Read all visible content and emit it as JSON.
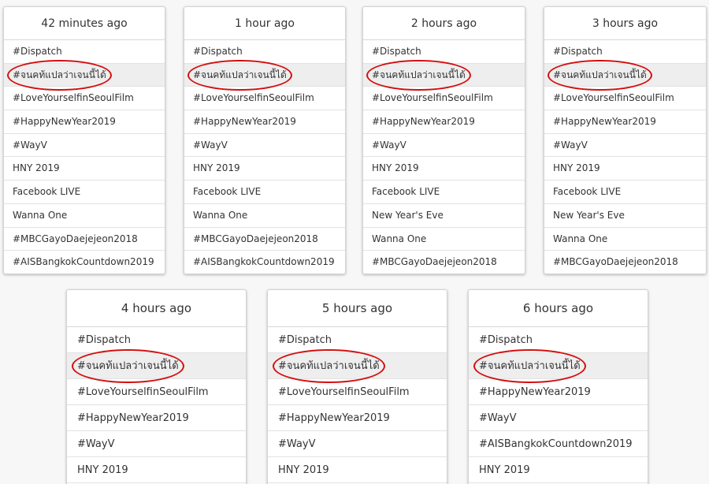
{
  "panels": [
    {
      "header": "42 minutes ago",
      "items": [
        "#Dispatch",
        "#จนคท้แปลว่าเจนนี้ได้",
        "#LoveYourselfinSeoulFilm",
        "#HappyNewYear2019",
        "#WayV",
        "HNY 2019",
        "Facebook LIVE",
        "Wanna One",
        "#MBCGayoDaejejeon2018",
        "#AISBangkokCountdown2019"
      ]
    },
    {
      "header": "1 hour ago",
      "items": [
        "#Dispatch",
        "#จนคท้แปลว่าเจนนี้ได้",
        "#LoveYourselfinSeoulFilm",
        "#HappyNewYear2019",
        "#WayV",
        "HNY 2019",
        "Facebook LIVE",
        "Wanna One",
        "#MBCGayoDaejejeon2018",
        "#AISBangkokCountdown2019"
      ]
    },
    {
      "header": "2 hours ago",
      "items": [
        "#Dispatch",
        "#จนคท้แปลว่าเจนนี้ได้",
        "#LoveYourselfinSeoulFilm",
        "#HappyNewYear2019",
        "#WayV",
        "HNY 2019",
        "Facebook LIVE",
        "New Year's Eve",
        "Wanna One",
        "#MBCGayoDaejejeon2018"
      ]
    },
    {
      "header": "3 hours ago",
      "items": [
        "#Dispatch",
        "#จนคท้แปลว่าเจนนี้ได้",
        "#LoveYourselfinSeoulFilm",
        "#HappyNewYear2019",
        "#WayV",
        "HNY 2019",
        "Facebook LIVE",
        "New Year's Eve",
        "Wanna One",
        "#MBCGayoDaejejeon2018"
      ]
    },
    {
      "header": "4 hours ago",
      "items": [
        "#Dispatch",
        "#จนคท้แปลว่าเจนนี้ได้",
        "#LoveYourselfinSeoulFilm",
        "#HappyNewYear2019",
        "#WayV",
        "HNY 2019"
      ]
    },
    {
      "header": "5 hours ago",
      "items": [
        "#Dispatch",
        "#จนคท้แปลว่าเจนนี้ได้",
        "#LoveYourselfinSeoulFilm",
        "#HappyNewYear2019",
        "#WayV",
        "HNY 2019"
      ]
    },
    {
      "header": "6 hours ago",
      "items": [
        "#Dispatch",
        "#จนคท้แปลว่าเจนนี้ได้",
        "#HappyNewYear2019",
        "#WayV",
        "#AISBangkokCountdown2019",
        "HNY 2019"
      ]
    }
  ],
  "highlight_color": "#d40f0f",
  "highlight_row_bg": "#eeeeee"
}
